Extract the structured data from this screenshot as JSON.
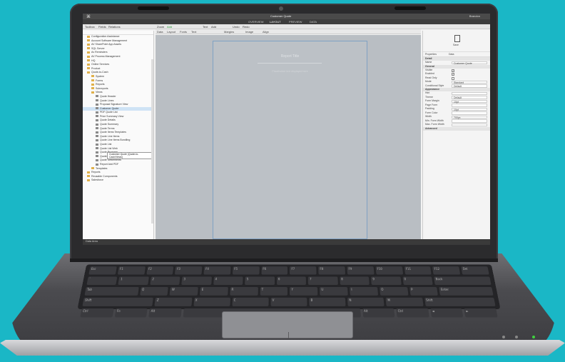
{
  "app": {
    "document_title": "Customer Quote",
    "user": "Brandon",
    "subtabs": [
      "OVERVIEW",
      "LAYOUT",
      "PREVIEW",
      "DATA"
    ],
    "toolbar1": [
      "Toolbox",
      "Fields",
      "Relations",
      "Zoom",
      "Add",
      "Text",
      "Add",
      "Undo",
      "Redo",
      "Remove",
      "Image",
      "Align"
    ],
    "toolbar2": [
      "Data",
      "Layout",
      "Fonts",
      "Text",
      "Fonts",
      "Margins",
      "Image",
      "Align"
    ],
    "status": "Data Area"
  },
  "tree": {
    "items": [
      {
        "label": "Configuration Assistance",
        "type": "folder",
        "indent": 1
      },
      {
        "label": "Account Software Management",
        "type": "folder",
        "indent": 1
      },
      {
        "label": "AV SharePoint App Assets",
        "type": "folder",
        "indent": 1
      },
      {
        "label": "SQL Server",
        "type": "folder",
        "indent": 1
      },
      {
        "label": "Av Reminders",
        "type": "folder",
        "indent": 1
      },
      {
        "label": "AV Process Management",
        "type": "folder",
        "indent": 1
      },
      {
        "label": "HQ",
        "type": "folder",
        "indent": 1
      },
      {
        "label": "Online Services",
        "type": "folder",
        "indent": 1
      },
      {
        "label": "Product",
        "type": "folder",
        "indent": 1
      },
      {
        "label": "Quote-to-Cash",
        "type": "folder",
        "indent": 1
      },
      {
        "label": "System",
        "type": "folder",
        "indent": 2
      },
      {
        "label": "Forms",
        "type": "folder",
        "indent": 2
      },
      {
        "label": "Reports",
        "type": "folder",
        "indent": 2
      },
      {
        "label": "Subreports",
        "type": "folder",
        "indent": 2
      },
      {
        "label": "Views",
        "type": "folder",
        "indent": 2
      },
      {
        "label": "Quote Header",
        "type": "file",
        "indent": 3
      },
      {
        "label": "Quote Lines",
        "type": "file",
        "indent": 3
      },
      {
        "label": "Proposal Signature View",
        "type": "file",
        "indent": 3
      },
      {
        "label": "Customer Quote",
        "type": "file",
        "indent": 3,
        "selected": true
      },
      {
        "label": "PDF Quote List",
        "type": "file",
        "indent": 3
      },
      {
        "label": "Price Summary View",
        "type": "file",
        "indent": 3
      },
      {
        "label": "Quote Details",
        "type": "file",
        "indent": 3
      },
      {
        "label": "Quote Summary",
        "type": "file",
        "indent": 3
      },
      {
        "label": "Quote Terms",
        "type": "file",
        "indent": 3
      },
      {
        "label": "Quote Items Templates",
        "type": "file",
        "indent": 3
      },
      {
        "label": "Quote Line Items",
        "type": "file",
        "indent": 3
      },
      {
        "label": "Quote Line Items Bundling",
        "type": "file",
        "indent": 3
      },
      {
        "label": "Quote List",
        "type": "file",
        "indent": 3
      },
      {
        "label": "Quote List Web",
        "type": "file",
        "indent": 3
      },
      {
        "label": "Quote Progress",
        "type": "file",
        "indent": 3
      },
      {
        "label": "Quote Signatures",
        "type": "file",
        "indent": 3
      },
      {
        "label": "Quote Settlements",
        "type": "file",
        "indent": 3
      },
      {
        "label": "Report Add PDF",
        "type": "file",
        "indent": 3
      },
      {
        "label": "Templates",
        "type": "folder",
        "indent": 2
      },
      {
        "label": "Reports",
        "type": "folder",
        "indent": 1
      },
      {
        "label": "Reusable Components",
        "type": "folder",
        "indent": 1
      },
      {
        "label": "Salesforce",
        "type": "folder",
        "indent": 1
      }
    ],
    "tooltip": "Customer Quote (Quote-to-Cash/Views)"
  },
  "canvas": {
    "page_title": "Report Title",
    "page_subtitle": "Placeholder text displayed here"
  },
  "props": {
    "save_label": "Save",
    "tabs": [
      "Properties",
      "Data"
    ],
    "sections": [
      {
        "title": "Detail",
        "rows": [
          {
            "label": "Name",
            "value": "Customer Quote"
          }
        ]
      },
      {
        "title": "General",
        "rows": [
          {
            "label": "Visible",
            "check": true
          },
          {
            "label": "Enabled",
            "check": true
          },
          {
            "label": "Read Only",
            "check": false
          },
          {
            "label": "Mode",
            "value": "Standard"
          },
          {
            "label": "Conditional Style",
            "value": "Default"
          }
        ]
      },
      {
        "title": "Appearance",
        "rows": [
          {
            "label": "Hint",
            "value": ""
          },
          {
            "label": "Theme",
            "value": "Default"
          },
          {
            "label": "Form Margin",
            "value": "10pt"
          },
          {
            "label": "Page Form",
            "value": ""
          },
          {
            "label": "Padding",
            "value": "10pt"
          },
          {
            "label": "Form Color",
            "value": ""
          },
          {
            "label": "Width",
            "value": "700px"
          },
          {
            "label": "Min. Form Width",
            "value": ""
          },
          {
            "label": "Max. Form Width",
            "value": ""
          }
        ]
      },
      {
        "title": "Advanced",
        "rows": []
      }
    ]
  },
  "colors": {
    "background": "#1ab7c6",
    "selection": "#cfe3f5",
    "canvas": "#b9bec3"
  }
}
